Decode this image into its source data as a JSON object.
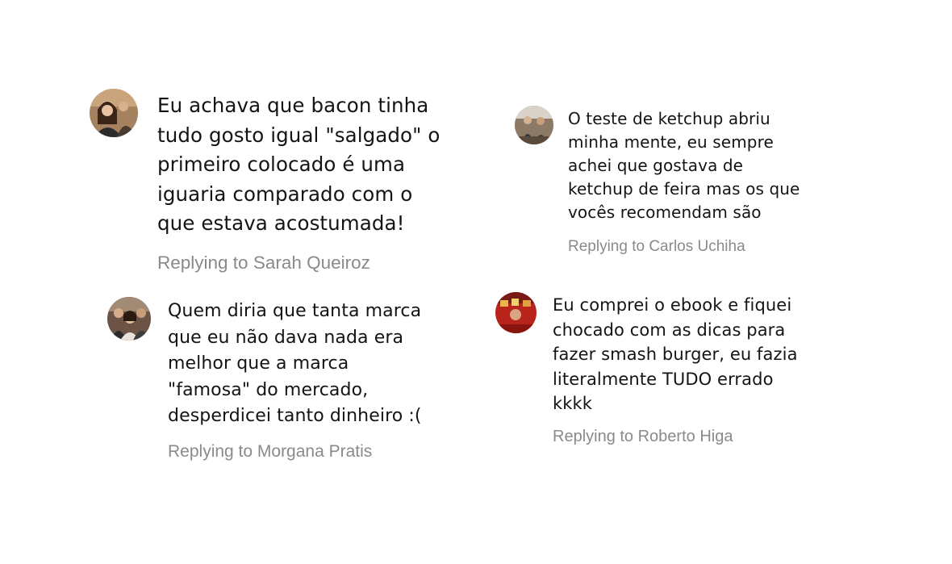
{
  "comments": [
    {
      "text": "Eu achava que bacon tinha\ntudo gosto igual \"salgado\" o\nprimeiro colocado é uma\niguaria comparado com o\nque estava acostumada!",
      "reply": "Replying to Sarah Queiroz",
      "avatar_icon": "user-photo-icon"
    },
    {
      "text": "O teste de ketchup abriu\nminha mente, eu sempre\nachei que gostava de\nketchup de feira mas os que\nvocês recomendam são",
      "reply": "Replying to Carlos Uchiha",
      "avatar_icon": "user-photo-icon"
    },
    {
      "text": "Quem diria que tanta marca\nque eu não dava nada era\nmelhor que a marca\n\"famosa\" do mercado,\ndesperdicei tanto dinheiro :(",
      "reply": "Replying to Morgana Pratis",
      "avatar_icon": "user-photo-icon"
    },
    {
      "text": "Eu comprei o ebook e fiquei\nchocado com as dicas para\nfazer smash burger, eu fazia\nliteralmente TUDO errado\nkkkk",
      "reply": "Replying to Roberto Higa",
      "avatar_icon": "user-photo-icon"
    }
  ],
  "colors": {
    "text": "#141414",
    "reply": "#8a8a8a",
    "background": "#ffffff"
  }
}
